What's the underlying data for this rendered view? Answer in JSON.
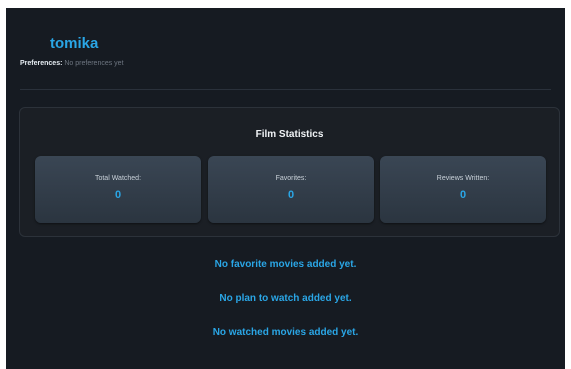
{
  "profile": {
    "username": "tomika",
    "preferences_label": "Preferences:",
    "preferences_value": "No preferences yet"
  },
  "stats": {
    "title": "Film Statistics",
    "items": [
      {
        "label": "Total Watched:",
        "value": "0"
      },
      {
        "label": "Favorites:",
        "value": "0"
      },
      {
        "label": "Reviews Written:",
        "value": "0"
      }
    ]
  },
  "lists": {
    "favorites_empty": "No favorite movies added yet.",
    "plan_empty": "No plan to watch added yet.",
    "watched_empty": "No watched movies added yet."
  },
  "colors": {
    "background": "#161b22",
    "accent": "#2aa6e6",
    "card": "#1b1f25",
    "stat_box": "#33404c"
  }
}
